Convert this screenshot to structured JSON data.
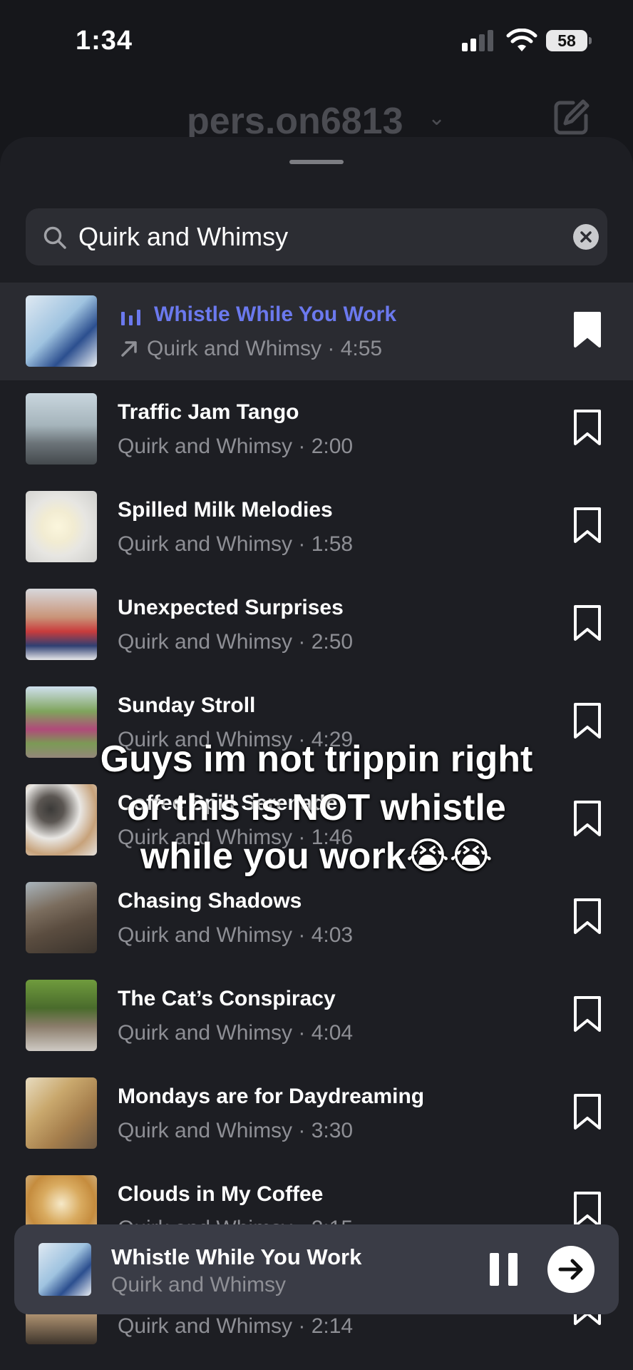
{
  "status_bar": {
    "time": "1:34",
    "battery": "58"
  },
  "header": {
    "account": "pers.on6813"
  },
  "search": {
    "value": "Quirk and Whimsy"
  },
  "tracks": [
    {
      "title": "Whistle While You Work",
      "sub": "Quirk and Whimsy · 4:55",
      "active": true,
      "saved": true
    },
    {
      "title": "Traffic Jam Tango",
      "sub": "Quirk and Whimsy · 2:00"
    },
    {
      "title": "Spilled Milk Melodies",
      "sub": "Quirk and Whimsy · 1:58"
    },
    {
      "title": "Unexpected Surprises",
      "sub": "Quirk and Whimsy · 2:50"
    },
    {
      "title": "Sunday Stroll",
      "sub": "Quirk and Whimsy · 4:29"
    },
    {
      "title": "Coffee Spill Serenade",
      "sub": "Quirk and Whimsy · 1:46"
    },
    {
      "title": "Chasing Shadows",
      "sub": "Quirk and Whimsy · 4:03"
    },
    {
      "title": "The Cat’s Conspiracy",
      "sub": "Quirk and Whimsy · 4:04"
    },
    {
      "title": "Mondays are for Daydreaming",
      "sub": "Quirk and Whimsy · 3:30"
    },
    {
      "title": "Clouds in My Coffee",
      "sub": "Quirk and Whimsy · 2:15"
    },
    {
      "title": "",
      "sub": "Quirk and Whimsy · 2:14"
    }
  ],
  "caption": {
    "line1": "Guys im not trippin right",
    "line2": "or this is NOT whistle",
    "line3": "while you work😭😭"
  },
  "now_playing": {
    "title": "Whistle While You Work",
    "artist": "Quirk and Whimsy"
  },
  "colors": {
    "accent": "#6b79ee",
    "background": "#16171b",
    "sheet": "#1d1e23",
    "player": "#3a3c46"
  }
}
